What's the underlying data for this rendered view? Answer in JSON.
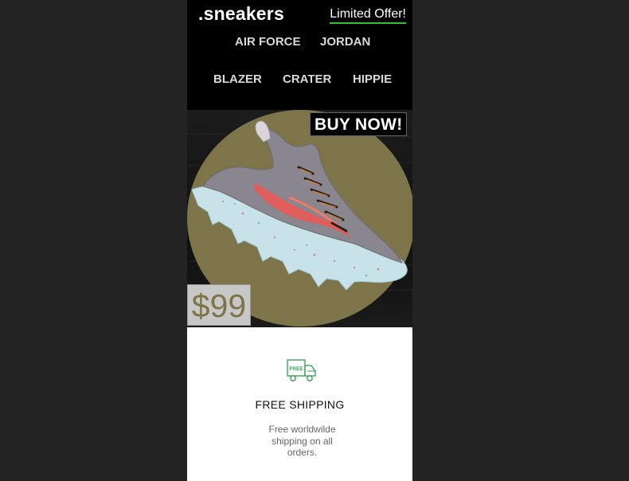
{
  "header": {
    "logo": ".sneakers",
    "offer_link": "Limited Offer!"
  },
  "nav": {
    "items": [
      {
        "label": "AIR FORCE"
      },
      {
        "label": "JORDAN"
      },
      {
        "label": "BLAZER"
      },
      {
        "label": "CRATER"
      },
      {
        "label": "HIPPIE"
      }
    ]
  },
  "hero": {
    "cta": "BUY NOW!",
    "price": "$99",
    "image": "sneaker-photo"
  },
  "feature": {
    "icon": "free-shipping-truck-icon",
    "icon_text": "FREE",
    "title": "FREE SHIPPING",
    "description": "Free worldwilde shipping on all orders."
  },
  "colors": {
    "page_background": "#232323",
    "header_background": "#000000",
    "hero_circle": "#7d7549",
    "accent_green": "#2bbf3a",
    "icon_green": "#2e9e4f"
  }
}
